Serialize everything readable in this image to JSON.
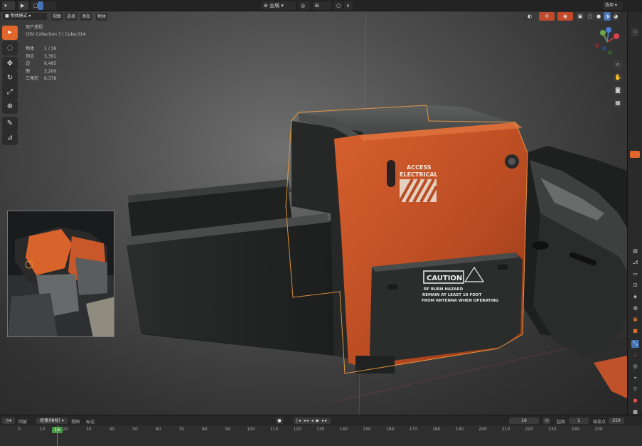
{
  "header": {
    "view_menu": "视图",
    "select_menu": "选择",
    "add_menu": "添加",
    "object_menu": "物体",
    "mode_select": "物体模式",
    "transform_orientation": "全局",
    "right_options": "选项"
  },
  "overlay": {
    "view_name": "用户透视",
    "object_path": "(26) Collection 3 | Cube.014",
    "stats": [
      {
        "label": "物体",
        "value": "1 / 36"
      },
      {
        "label": "顶点",
        "value": "3,391"
      },
      {
        "label": "边",
        "value": "6,495"
      },
      {
        "label": "面",
        "value": "3,200"
      },
      {
        "label": "三角形",
        "value": "6,378"
      }
    ]
  },
  "decals": {
    "access_line1": "ACCESS",
    "access_line2": "ELECTRICAL",
    "caution_title": "CAUTION",
    "caution_line1": "RF BURN HAZARD",
    "caution_line2": "REMAIN AT LEAST 10 FOOT",
    "caution_line3": "FROM ANTENNA WHEN OPERATING"
  },
  "timeline": {
    "playback_menu": "回放",
    "keying_menu": "抠像(插帧)",
    "view_menu": "视图",
    "marker_menu": "标记",
    "current_frame": "16",
    "start_label": "起始",
    "start_value": "1",
    "end_label": "结束点",
    "end_value": "250",
    "cursor_frame": "16",
    "ticks": [
      "0",
      "10",
      "20",
      "30",
      "40",
      "50",
      "60",
      "70",
      "80",
      "90",
      "100",
      "110",
      "120",
      "130",
      "140",
      "150",
      "160",
      "170",
      "180",
      "190",
      "200",
      "210",
      "220",
      "230",
      "240",
      "250"
    ]
  },
  "colors": {
    "accent": "#e0662b",
    "selection_outline": "#f0a040",
    "playhead": "#4a9c46",
    "panel_orange": "#c8552a"
  }
}
